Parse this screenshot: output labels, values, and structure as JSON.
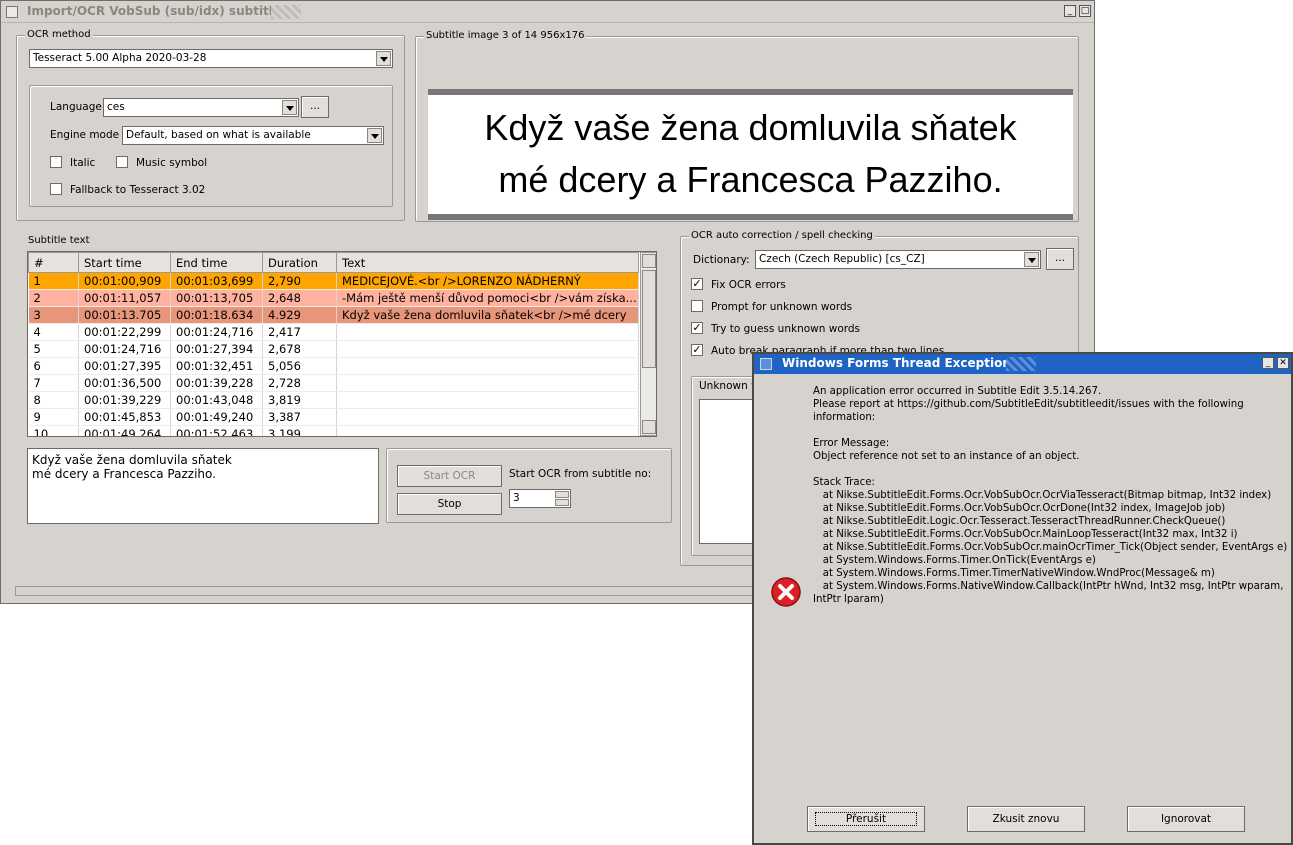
{
  "main_window": {
    "title": "Import/OCR VobSub (sub/idx) subtitle",
    "ocr_method": {
      "legend": "OCR method",
      "engine": "Tesseract 5.00 Alpha 2020-03-28",
      "language_label": "Language",
      "language": "ces",
      "browse_label": "...",
      "engine_mode_label": "Engine mode",
      "engine_mode": "Default, based on what is available",
      "italic_label": "Italic",
      "music_label": "Music symbol",
      "fallback_label": "Fallback to Tesseract 3.02"
    },
    "preview": {
      "legend": "Subtitle image 3 of 14   956x176",
      "line1": "Když vaše žena domluvila sňatek",
      "line2": "mé dcery a Francesca Pazziho."
    },
    "subtitle_text": {
      "legend": "Subtitle text",
      "columns": [
        "#",
        "Start time",
        "End time",
        "Duration",
        "Text"
      ],
      "rows": [
        {
          "num": "1",
          "start": "00:01:00,909",
          "end": "00:01:03,699",
          "dur": "2,790",
          "text": "MEDICEJOVÉ.<br />LORENZO NÁDHERNÝ",
          "bg": "#ffa500"
        },
        {
          "num": "2",
          "start": "00:01:11,057",
          "end": "00:01:13,705",
          "dur": "2,648",
          "text": "-Mám ještě menší důvod pomoci<br />vám získa...",
          "bg": "#ffb2a0"
        },
        {
          "num": "3",
          "start": "00:01:13.705",
          "end": "00:01:18.634",
          "dur": "4.929",
          "text": "Když vaše žena domluvila sňatek<br />mé dcery",
          "bg": "#e8967a"
        },
        {
          "num": "4",
          "start": "00:01:22,299",
          "end": "00:01:24,716",
          "dur": "2,417",
          "text": "",
          "bg": "#ffffff"
        },
        {
          "num": "5",
          "start": "00:01:24,716",
          "end": "00:01:27,394",
          "dur": "2,678",
          "text": "",
          "bg": "#ffffff"
        },
        {
          "num": "6",
          "start": "00:01:27,395",
          "end": "00:01:32,451",
          "dur": "5,056",
          "text": "",
          "bg": "#ffffff"
        },
        {
          "num": "7",
          "start": "00:01:36,500",
          "end": "00:01:39,228",
          "dur": "2,728",
          "text": "",
          "bg": "#ffffff"
        },
        {
          "num": "8",
          "start": "00:01:39,229",
          "end": "00:01:43,048",
          "dur": "3,819",
          "text": "",
          "bg": "#ffffff"
        },
        {
          "num": "9",
          "start": "00:01:45,853",
          "end": "00:01:49,240",
          "dur": "3,387",
          "text": "",
          "bg": "#ffffff"
        },
        {
          "num": "10",
          "start": "00:01:49,264",
          "end": "00:01:52,463",
          "dur": "3,199",
          "text": "",
          "bg": "#ffffff"
        }
      ],
      "current_line1": "Když vaše žena domluvila sňatek",
      "current_line2": "mé dcery a Francesca Pazziho."
    },
    "controls": {
      "start_ocr": "Start OCR",
      "stop": "Stop",
      "start_from_label": "Start OCR from subtitle no:",
      "start_from_value": "3"
    },
    "autocorrect": {
      "legend": "OCR auto correction / spell checking",
      "dictionary_label": "Dictionary:",
      "dictionary": "Czech (Czech Republic) [cs_CZ]",
      "browse_label": "...",
      "fix_ocr": "Fix OCR errors",
      "prompt_unknown": "Prompt for unknown words",
      "guess_unknown": "Try to guess unknown words",
      "auto_break": "Auto break paragraph if more than two lines",
      "unknown_words_legend": "Unknown w"
    }
  },
  "dialog": {
    "title": "Windows Forms Thread Exception",
    "message_lines": [
      "An application error occurred in Subtitle Edit 3.5.14.267.",
      "Please report at https://github.com/SubtitleEdit/subtitleedit/issues with the following",
      "information:",
      "",
      "Error Message:",
      "Object reference not set to an instance of an object.",
      "",
      "Stack Trace:",
      "   at Nikse.SubtitleEdit.Forms.Ocr.VobSubOcr.OcrViaTesseract(Bitmap bitmap, Int32 index)",
      "   at Nikse.SubtitleEdit.Forms.Ocr.VobSubOcr.OcrDone(Int32 index, ImageJob job)",
      "   at Nikse.SubtitleEdit.Logic.Ocr.Tesseract.TesseractThreadRunner.CheckQueue()",
      "   at Nikse.SubtitleEdit.Forms.Ocr.VobSubOcr.MainLoopTesseract(Int32 max, Int32 i)",
      "   at Nikse.SubtitleEdit.Forms.Ocr.VobSubOcr.mainOcrTimer_Tick(Object sender, EventArgs e)",
      "   at System.Windows.Forms.Timer.OnTick(EventArgs e)",
      "   at System.Windows.Forms.Timer.TimerNativeWindow.WndProc(Message& m)",
      "   at System.Windows.Forms.NativeWindow.Callback(IntPtr hWnd, Int32 msg, IntPtr wparam,",
      "IntPtr lparam)"
    ],
    "abort": "Přerušit",
    "retry": "Zkusit znovu",
    "ignore": "Ignorovat"
  },
  "icons": {
    "error_icon": "error-icon",
    "error_color": "#dd1f26"
  }
}
